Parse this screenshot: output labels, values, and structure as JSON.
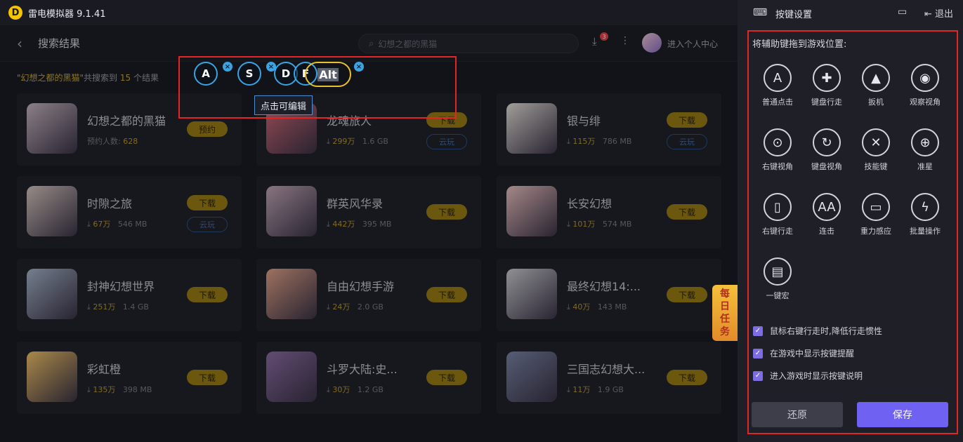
{
  "app": {
    "title": "雷电模拟器 9.1.41",
    "logo_letter": "D"
  },
  "header": {
    "back_glyph": "‹",
    "title": "搜索结果",
    "search_placeholder": "幻想之都的黑猫",
    "download_badge": "3",
    "user_center": "进入个人中心"
  },
  "summary": {
    "query": "\"幻想之都的黑猫\"",
    "prefix": "共搜索到",
    "count": "15",
    "suffix": "个结果"
  },
  "games": [
    {
      "name": "幻想之都的黑猫",
      "meta_label": "预约人数:",
      "meta_value": "628",
      "size": "",
      "button": "预约",
      "cloud": "",
      "icon_color": "#c9b8c4"
    },
    {
      "name": "龙魂旅人",
      "meta_label": "⤓",
      "meta_value": "299万",
      "size": "1.6 GB",
      "button": "下载",
      "cloud": "云玩",
      "icon_color": "#d36a78"
    },
    {
      "name": "银与绯",
      "meta_label": "⤓",
      "meta_value": "115万",
      "size": "786 MB",
      "button": "下载",
      "cloud": "云玩",
      "icon_color": "#e7e2dc"
    },
    {
      "name": "时隙之旅",
      "meta_label": "⤓",
      "meta_value": "67万",
      "size": "546 MB",
      "button": "下载",
      "cloud": "云玩",
      "icon_color": "#d8c8c2"
    },
    {
      "name": "群英风华录",
      "meta_label": "⤓",
      "meta_value": "442万",
      "size": "395 MB",
      "button": "下载",
      "cloud": "",
      "icon_color": "#c3a9b9"
    },
    {
      "name": "长安幻想",
      "meta_label": "⤓",
      "meta_value": "101万",
      "size": "574 MB",
      "button": "下载",
      "cloud": "",
      "icon_color": "#edc3c3"
    },
    {
      "name": "封神幻想世界",
      "meta_label": "⤓",
      "meta_value": "251万",
      "size": "1.4 GB",
      "button": "下载",
      "cloud": "",
      "icon_color": "#a7b6cc"
    },
    {
      "name": "自由幻想手游",
      "meta_label": "⤓",
      "meta_value": "24万",
      "size": "2.0 GB",
      "button": "下载",
      "cloud": "",
      "icon_color": "#e3a38a"
    },
    {
      "name": "最终幻想14:...",
      "meta_label": "⤓",
      "meta_value": "40万",
      "size": "143 MB",
      "button": "下载",
      "cloud": "",
      "icon_color": "#cfcfd5"
    },
    {
      "name": "彩虹橙",
      "meta_label": "⤓",
      "meta_value": "135万",
      "size": "398 MB",
      "button": "下载",
      "cloud": "",
      "icon_color": "#f3c46a"
    },
    {
      "name": "斗罗大陆:史...",
      "meta_label": "⤓",
      "meta_value": "30万",
      "size": "1.2 GB",
      "button": "下载",
      "cloud": "",
      "icon_color": "#8e6ea6"
    },
    {
      "name": "三国志幻想大...",
      "meta_label": "⤓",
      "meta_value": "11万",
      "size": "1.9 GB",
      "button": "下载",
      "cloud": "",
      "icon_color": "#7b86a8"
    }
  ],
  "overlay": {
    "keys": [
      "A",
      "S",
      "D",
      "F"
    ],
    "remove_glyph": "×",
    "alt_key": "Alt",
    "tooltip": "点击可编辑"
  },
  "float_banner": {
    "lines": [
      "每",
      "日",
      "任",
      "务"
    ]
  },
  "panel": {
    "title": "按键设置",
    "exit": "退出",
    "instruction": "将辅助键拖到游戏位置:",
    "tools": [
      {
        "label": "普通点击",
        "glyph": "A",
        "icon": "tap-icon"
      },
      {
        "label": "键盘行走",
        "glyph": "✚",
        "icon": "dpad-icon"
      },
      {
        "label": "扳机",
        "glyph": "▲",
        "icon": "trigger-icon"
      },
      {
        "label": "观察视角",
        "glyph": "◉",
        "icon": "eye-icon"
      },
      {
        "label": "右键视角",
        "glyph": "⊙",
        "icon": "rotate-view-icon"
      },
      {
        "label": "键盘视角",
        "glyph": "↻",
        "icon": "keyboard-view-icon"
      },
      {
        "label": "技能键",
        "glyph": "✕",
        "icon": "sword-icon"
      },
      {
        "label": "准星",
        "glyph": "⊕",
        "icon": "crosshair-icon"
      },
      {
        "label": "右键行走",
        "glyph": "▯",
        "icon": "mouse-icon"
      },
      {
        "label": "连击",
        "glyph": "AA",
        "icon": "combo-icon"
      },
      {
        "label": "重力感应",
        "glyph": "▭",
        "icon": "gravity-icon"
      },
      {
        "label": "批量操作",
        "glyph": "ϟ",
        "icon": "bolt-icon"
      },
      {
        "label": "一键宏",
        "glyph": "▤",
        "icon": "macro-icon"
      }
    ],
    "options": [
      "鼠标右键行走时,降低行走惯性",
      "在游戏中显示按键提醒",
      "进入游戏时显示按键说明"
    ],
    "reset": "还原",
    "save": "保存"
  }
}
